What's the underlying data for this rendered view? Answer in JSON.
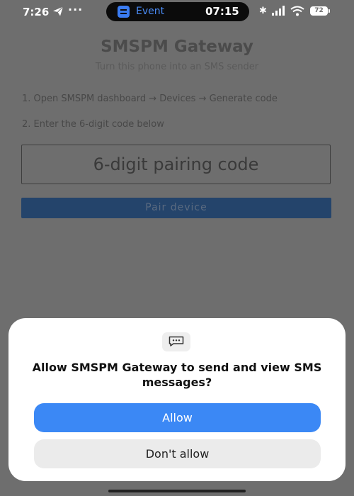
{
  "status_bar": {
    "time": "7:26",
    "dots": "···",
    "event_label": "Event",
    "clock": "07:15",
    "battery": "72"
  },
  "app": {
    "title": "SMSPM Gateway",
    "subtitle": "Turn this phone into an SMS sender",
    "step1": "1. Open SMSPM dashboard → Devices → Generate code",
    "step2": "2. Enter the 6-digit code below",
    "code_placeholder": "6-digit pairing code",
    "pair_button": "Pair device"
  },
  "dialog": {
    "question": "Allow SMSPM Gateway to send and view SMS messages?",
    "allow": "Allow",
    "deny": "Don't allow",
    "icon": "sms-bubble-icon"
  },
  "colors": {
    "scrim": "#6e6e6e",
    "accent": "#3b88f5",
    "island_accent": "#4a8cf7",
    "pair_button_bg": "#24446b"
  }
}
